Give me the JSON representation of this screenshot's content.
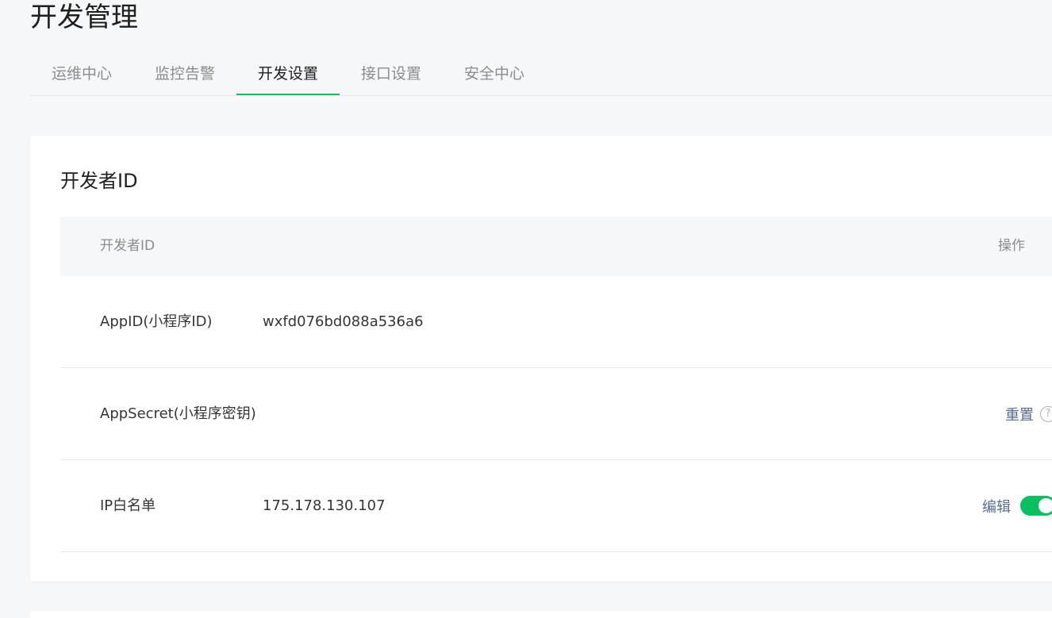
{
  "page": {
    "title": "开发管理"
  },
  "tabs": [
    {
      "label": "运维中心",
      "active": false
    },
    {
      "label": "监控告警",
      "active": false
    },
    {
      "label": "开发设置",
      "active": true
    },
    {
      "label": "接口设置",
      "active": false
    },
    {
      "label": "安全中心",
      "active": false
    }
  ],
  "colors": {
    "accent": "#07c160",
    "link": "#576b95",
    "background": "#f6f7f9"
  },
  "developer_card": {
    "title": "开发者ID",
    "table": {
      "headers": {
        "id": "开发者ID",
        "action": "操作"
      },
      "rows": [
        {
          "label": "AppID(小程序ID)",
          "value": "wxfd076bd088a536a6"
        },
        {
          "label": "AppSecret(小程序密钥)",
          "value": "",
          "action_label": "重置",
          "action_icon": "help-icon"
        },
        {
          "label": "IP白名单",
          "value": "175.178.130.107",
          "action_label": "编辑",
          "toggle_on": true
        }
      ]
    }
  }
}
